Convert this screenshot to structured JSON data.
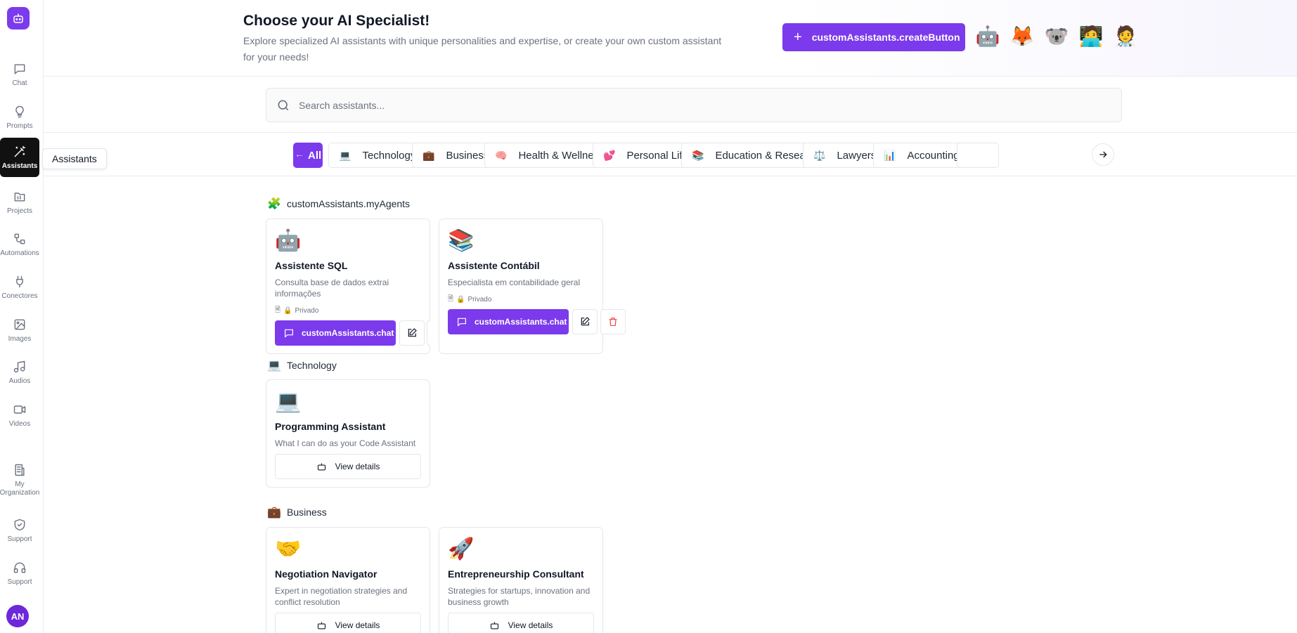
{
  "sidebar": {
    "items": [
      {
        "label": "Chat",
        "icon": "chat-icon"
      },
      {
        "label": "Prompts",
        "icon": "lightbulb-icon"
      },
      {
        "label": "Assistants",
        "icon": "magic-wand-icon"
      },
      {
        "label": "Projects",
        "icon": "folder-icon"
      },
      {
        "label": "Automations",
        "icon": "workflow-icon"
      },
      {
        "label": "Conectores",
        "icon": "plug-icon"
      },
      {
        "label": "Images",
        "icon": "image-icon"
      },
      {
        "label": "Audios",
        "icon": "music-icon"
      },
      {
        "label": "Videos",
        "icon": "video-icon"
      },
      {
        "label": "My Organization",
        "icon": "building-icon"
      },
      {
        "label": "Support",
        "icon": "shield-icon"
      },
      {
        "label": "Support",
        "icon": "headphones-icon"
      }
    ],
    "tooltip": "Assistants",
    "avatar": "AN"
  },
  "header": {
    "title": "Choose your AI Specialist!",
    "subtitle": "Explore specialized AI assistants with unique personalities and expertise, or create your own custom assistant for your needs!",
    "create_button": "customAssistants.createButton",
    "emojis": [
      "🤖",
      "🦊",
      "🐨",
      "🧑‍💻",
      "🧑‍⚕️"
    ]
  },
  "search": {
    "placeholder": "Search assistants..."
  },
  "categories": [
    {
      "label": "All",
      "icon": ""
    },
    {
      "label": "Technology",
      "icon": "💻"
    },
    {
      "label": "Business",
      "icon": "💼"
    },
    {
      "label": "Health & Wellness",
      "icon": "🧠"
    },
    {
      "label": "Personal Life",
      "icon": "💕"
    },
    {
      "label": "Education & Research",
      "icon": "📚"
    },
    {
      "label": "Lawyers",
      "icon": "⚖️"
    },
    {
      "label": "Accounting",
      "icon": "📊"
    }
  ],
  "sections": {
    "my_agents": {
      "title": "customAssistants.myAgents",
      "icon": "🧩",
      "cards": [
        {
          "emoji": "🤖",
          "title": "Assistente SQL",
          "description": "Consulta base de dados extrai informações",
          "meta": "Privado",
          "chat_label": "customAssistants.chat"
        },
        {
          "emoji": "📚",
          "title": "Assistente Contábil",
          "description": "Especialista em contabilidade geral",
          "meta": "Privado",
          "chat_label": "customAssistants.chat"
        }
      ]
    },
    "technology": {
      "title": "Technology",
      "icon": "💻",
      "cards": [
        {
          "emoji": "💻",
          "title": "Programming Assistant",
          "description": "What I can do as your Code Assistant",
          "button": "View details"
        }
      ]
    },
    "business": {
      "title": "Business",
      "icon": "💼",
      "cards": [
        {
          "emoji": "🤝",
          "title": "Negotiation Navigator",
          "description": "Expert in negotiation strategies and conflict resolution",
          "button": "View details"
        },
        {
          "emoji": "🚀",
          "title": "Entrepreneurship Consultant",
          "description": "Strategies for startups, innovation and business growth",
          "button": "View details"
        }
      ]
    }
  },
  "colors": {
    "accent": "#7c3aed",
    "delete": "#ef4444"
  }
}
